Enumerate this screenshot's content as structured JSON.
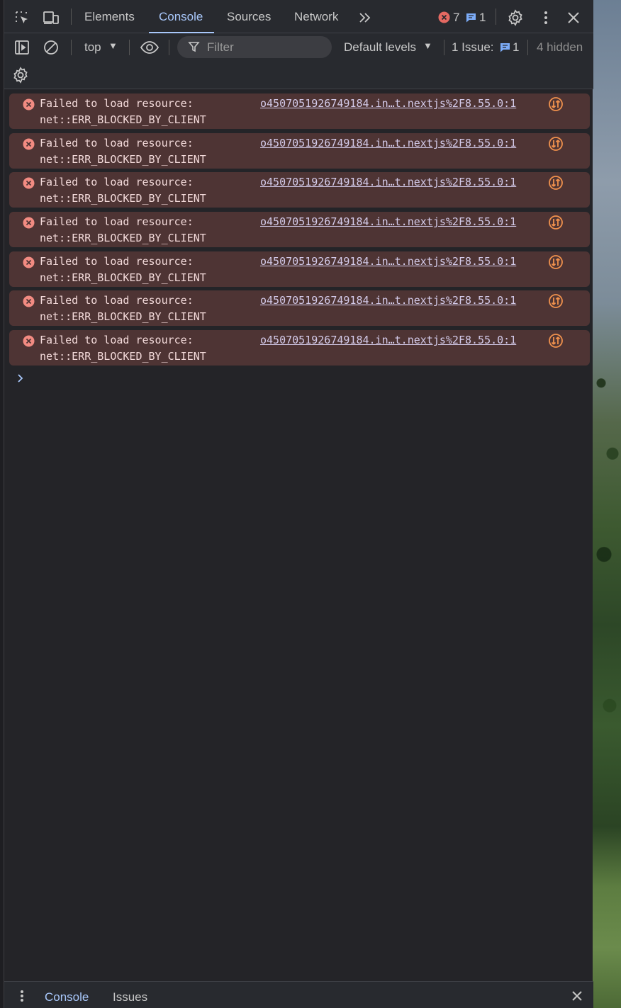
{
  "tabs": [
    {
      "label": "Elements"
    },
    {
      "label": "Console"
    },
    {
      "label": "Sources"
    },
    {
      "label": "Network"
    }
  ],
  "counts": {
    "errors": "7",
    "messages": "1"
  },
  "toolbar": {
    "context": "top",
    "filter_placeholder": "Filter",
    "levels": "Default levels",
    "issues_label": "1 Issue:",
    "issues_count": "1",
    "hidden": "4 hidden"
  },
  "messages": [
    {
      "text1": "Failed to load resource:",
      "text2": "net::ERR_BLOCKED_BY_CLIENT",
      "source": "o4507051926749184.in…t.nextjs%2F8.55.0:1"
    },
    {
      "text1": "Failed to load resource:",
      "text2": "net::ERR_BLOCKED_BY_CLIENT",
      "source": "o4507051926749184.in…t.nextjs%2F8.55.0:1"
    },
    {
      "text1": "Failed to load resource:",
      "text2": "net::ERR_BLOCKED_BY_CLIENT",
      "source": "o4507051926749184.in…t.nextjs%2F8.55.0:1"
    },
    {
      "text1": "Failed to load resource:",
      "text2": "net::ERR_BLOCKED_BY_CLIENT",
      "source": "o4507051926749184.in…t.nextjs%2F8.55.0:1"
    },
    {
      "text1": "Failed to load resource:",
      "text2": "net::ERR_BLOCKED_BY_CLIENT",
      "source": "o4507051926749184.in…t.nextjs%2F8.55.0:1"
    },
    {
      "text1": "Failed to load resource:",
      "text2": "net::ERR_BLOCKED_BY_CLIENT",
      "source": "o4507051926749184.in…t.nextjs%2F8.55.0:1"
    },
    {
      "text1": "Failed to load resource:",
      "text2": "net::ERR_BLOCKED_BY_CLIENT",
      "source": "o4507051926749184.in…t.nextjs%2F8.55.0:1"
    }
  ],
  "drawer": {
    "tabs": [
      {
        "label": "Console"
      },
      {
        "label": "Issues"
      }
    ]
  },
  "colors": {
    "accent": "#a8c7fa",
    "error_bg": "#4e3434",
    "error_icon": "#f28b82",
    "panel_bg": "#242428"
  }
}
